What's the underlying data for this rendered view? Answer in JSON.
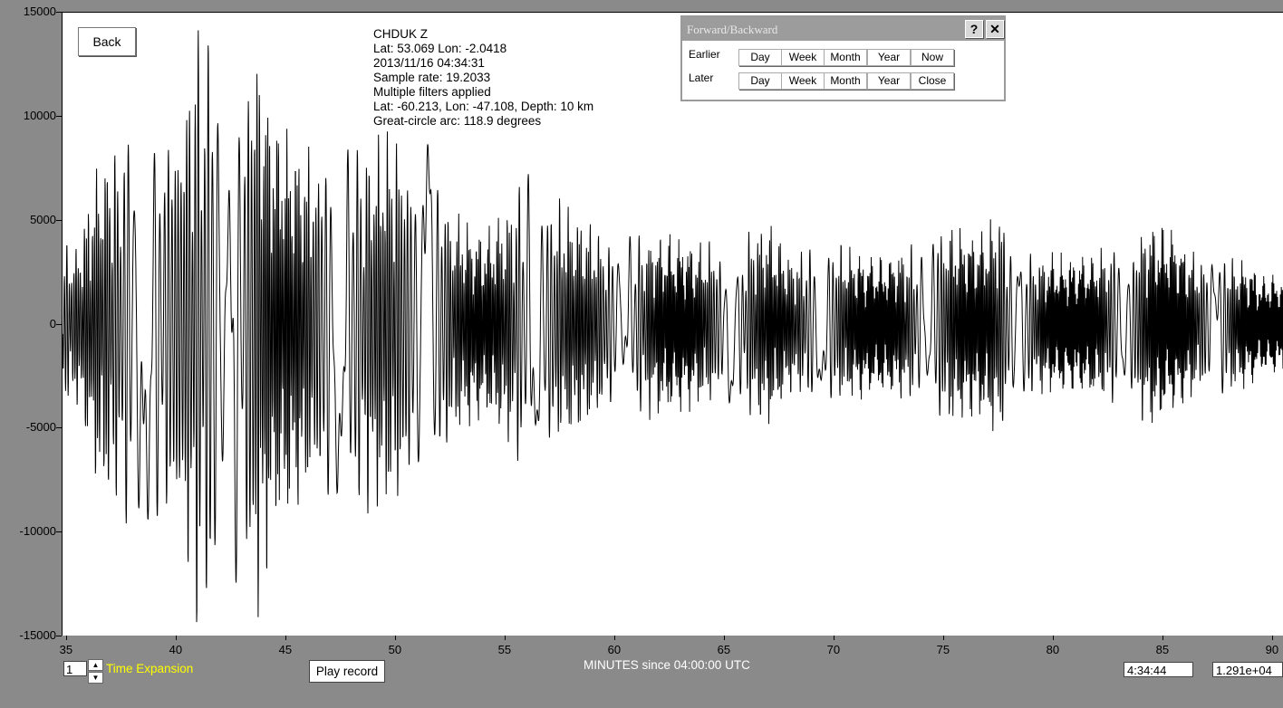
{
  "station_info": {
    "station": "CHDUK  Z",
    "station_location": "Lat: 53.069 Lon: -2.0418",
    "datetime": "2013/11/16 04:34:31",
    "sample_rate": "Sample rate: 19.2033",
    "filters": "Multiple filters applied",
    "event_location": "Lat: -60.213, Lon: -47.108, Depth: 10 km",
    "arc": "Great-circle arc: 118.9 degrees"
  },
  "back_button": "Back",
  "dialog": {
    "title": "Forward/Backward",
    "help_icon": "?",
    "close_icon": "✕",
    "earlier_label": "Earlier",
    "later_label": "Later",
    "earlier_buttons": [
      "Day",
      "Week",
      "Month",
      "Year",
      "Now"
    ],
    "later_buttons": [
      "Day",
      "Week",
      "Month",
      "Year",
      "Close"
    ]
  },
  "controls": {
    "time_expansion_value": "1",
    "time_expansion_label": "Time Expansion",
    "play_record": "Play record",
    "time_readout": "4:34:44",
    "value_readout": "1.291e+04"
  },
  "chart_data": {
    "type": "line",
    "title": "",
    "xlabel": "MINUTES since 04:00:00 UTC",
    "ylabel": "",
    "xlim": [
      34.8,
      90.5
    ],
    "ylim": [
      -15000,
      15000
    ],
    "x_ticks": [
      "35",
      "40",
      "45",
      "50",
      "55",
      "60",
      "65",
      "70",
      "75",
      "80",
      "85",
      "90"
    ],
    "y_ticks": [
      "15000",
      "10000",
      "5000",
      "0",
      "-5000",
      "-10000",
      "-15000"
    ],
    "grid": false,
    "series": [
      {
        "color": "#000000",
        "envelope_x": [
          34.8,
          35.5,
          36.5,
          37.5,
          38.5,
          39.2,
          40.0,
          41.0,
          41.6,
          42.2,
          43.0,
          43.6,
          44.5,
          45.5,
          47.0,
          48.5,
          49.5,
          51.0,
          51.5,
          52.5,
          54.0,
          55.0,
          56.0,
          57.0,
          58.0,
          60.0,
          62.0,
          64.0,
          66.0,
          67.0,
          68.0,
          70.0,
          72.0,
          74.0,
          75.0,
          76.5,
          77.5,
          79.0,
          81.0,
          83.0,
          84.5,
          85.5,
          86.5,
          88.0,
          90.5
        ],
        "envelope_amplitude": [
          3500,
          3500,
          7500,
          8000,
          9500,
          8500,
          9000,
          13000,
          14500,
          9000,
          12500,
          13000,
          9000,
          8000,
          7000,
          7500,
          8500,
          8000,
          9000,
          5000,
          4000,
          5000,
          6500,
          5500,
          5000,
          3500,
          4000,
          3500,
          4000,
          4500,
          3000,
          3500,
          3000,
          3500,
          4500,
          4000,
          5000,
          3000,
          3000,
          3500,
          4500,
          4000,
          3000,
          3000,
          2000
        ]
      }
    ]
  }
}
